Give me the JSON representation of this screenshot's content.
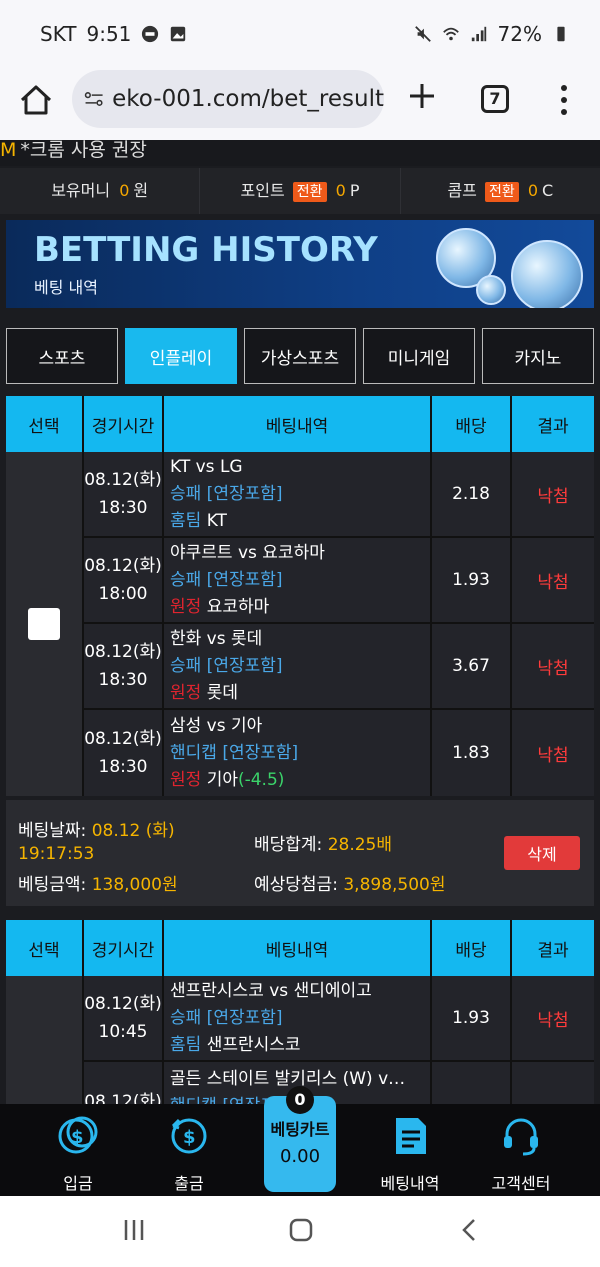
{
  "status_bar": {
    "carrier": "SKT",
    "time": "9:51",
    "battery": "72%"
  },
  "browser": {
    "url": "eko-001.com/bet_result",
    "tab_count": "7"
  },
  "notice": {
    "marker": "M",
    "text": "*크롬 사용 권장"
  },
  "wallet": {
    "money_label": "보유머니",
    "money_value": "0",
    "money_unit": "원",
    "point_label": "포인트",
    "point_badge": "전환",
    "point_value": "0",
    "point_unit": "P",
    "comp_label": "콤프",
    "comp_badge": "전환",
    "comp_value": "0",
    "comp_unit": "C"
  },
  "banner": {
    "title": "BETTING HISTORY",
    "subtitle": "베팅 내역"
  },
  "categories": [
    {
      "label": "스포츠",
      "active": false
    },
    {
      "label": "인플레이",
      "active": true
    },
    {
      "label": "가상스포츠",
      "active": false
    },
    {
      "label": "미니게임",
      "active": false
    },
    {
      "label": "카지노",
      "active": false
    }
  ],
  "table_headers": {
    "select": "선택",
    "time": "경기시간",
    "desc": "베팅내역",
    "odds": "배당",
    "result": "결과"
  },
  "bets": [
    {
      "rows": [
        {
          "date": "08.12(화)",
          "time": "18:30",
          "match": "KT vs LG",
          "market": "승패 [연장포함]",
          "pick_side": "홈팀",
          "pick_team": "KT",
          "handicap": "",
          "odds": "2.18",
          "result": "낙첨"
        },
        {
          "date": "08.12(화)",
          "time": "18:00",
          "match": "야쿠르트 vs 요코하마",
          "market": "승패 [연장포함]",
          "pick_side": "원정",
          "pick_team": "요코하마",
          "handicap": "",
          "odds": "1.93",
          "result": "낙첨"
        },
        {
          "date": "08.12(화)",
          "time": "18:30",
          "match": "한화 vs 롯데",
          "market": "승패 [연장포함]",
          "pick_side": "원정",
          "pick_team": "롯데",
          "handicap": "",
          "odds": "3.67",
          "result": "낙첨"
        },
        {
          "date": "08.12(화)",
          "time": "18:30",
          "match": "삼성 vs 기아",
          "market": "핸디캡 [연장포함]",
          "pick_side": "원정",
          "pick_team": "기아",
          "handicap": "(-4.5)",
          "odds": "1.83",
          "result": "낙첨"
        }
      ],
      "summary": {
        "bet_date_label": "베팅날짜:",
        "bet_date_value": "08.12 (화)",
        "bet_time_value": "19:17:53",
        "bet_amount_label": "베팅금액:",
        "bet_amount_value": "138,000원",
        "total_odds_label": "배당합계:",
        "total_odds_value": "28.25배",
        "expected_label": "예상당첨금:",
        "expected_value": "3,898,500원",
        "delete_label": "삭제"
      }
    },
    {
      "rows": [
        {
          "date": "08.12(화)",
          "time": "10:45",
          "match": "샌프란시스코 vs 샌디에이고",
          "market": "승패 [연장포함]",
          "pick_side": "홈팀",
          "pick_team": "샌프란시스코",
          "handicap": "",
          "odds": "1.93",
          "result": "낙첨"
        },
        {
          "date": "08.12(화)",
          "time": "",
          "match": "골든 스테이트 발키리스 (W) v…",
          "market": "핸디캡 [연장포",
          "pick_side": "",
          "pick_team": "",
          "handicap": "",
          "odds": "",
          "result": ""
        }
      ]
    }
  ],
  "bottom_nav": {
    "deposit": "입금",
    "withdraw": "출금",
    "cart_label": "베팅카트",
    "cart_value": "0.00",
    "cart_count": "0",
    "history": "베팅내역",
    "support": "고객센터"
  },
  "colors": {
    "accent": "#19b9ee",
    "loss": "#ff3b3b",
    "highlight": "#f5b400"
  }
}
